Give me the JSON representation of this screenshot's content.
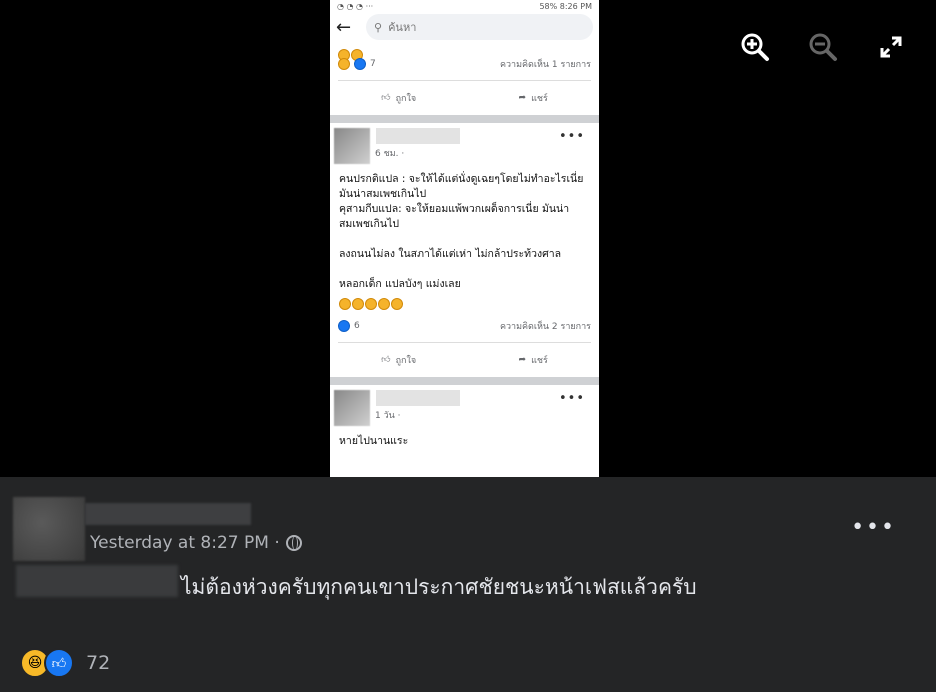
{
  "phone": {
    "status_right": "58% 8:26 PM",
    "search_placeholder": "ค้นหา",
    "post1": {
      "reaction_count": "7",
      "comments": "ความคิดเห็น 1 รายการ"
    },
    "actions": {
      "like": "ถูกใจ",
      "share": "แชร์"
    },
    "post2": {
      "time": "6 ชม. ·",
      "text": "คนปรกติแปล : จะให้ได้แต่นั่งดูเฉยๆโดยไม่ทำอะไรเนี่ย มันน่าสมเพชเกินไป\nคุสามกีบแปล: จะให้ยอมแพ้พวกเผด็จการเนี่ย มันน่าสมเพชเกินไป\n\nลงถนนไม่ลง ในสภาได้แต่เห่า ไม่กล้าประท้วงศาล\n\nหลอกเด็ก แปลบังๆ แม่งเลย",
      "reaction_count": "6",
      "comments": "ความคิดเห็น 2 รายการ"
    },
    "post3": {
      "time": "1 วัน ·",
      "text": "หายไปนานแระ"
    }
  },
  "comment": {
    "timestamp": "Yesterday at 8:27 PM ·",
    "text": "ไม่ต้องห่วงครับทุกคนเขาประกาศชัยชนะหน้าเฟสแล้วครับ",
    "reaction_count": "72"
  },
  "colors": {
    "accent": "#1877f2",
    "panel_bg": "#242526"
  }
}
